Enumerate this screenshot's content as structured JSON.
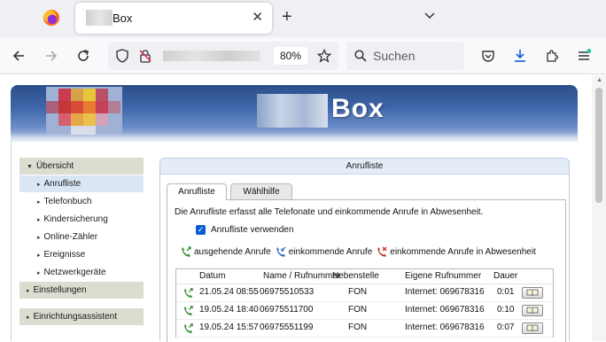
{
  "browser": {
    "tab_title": "Box",
    "url_zoom": "80%",
    "search_placeholder": "Suchen"
  },
  "header": {
    "title": "Box"
  },
  "sidebar": {
    "items": [
      {
        "label": "Übersicht",
        "level": "top",
        "expanded": true
      },
      {
        "label": "Anrufliste",
        "level": "sub",
        "selected": true
      },
      {
        "label": "Telefonbuch",
        "level": "sub"
      },
      {
        "label": "Kindersicherung",
        "level": "sub"
      },
      {
        "label": "Online-Zähler",
        "level": "sub"
      },
      {
        "label": "Ereignisse",
        "level": "sub"
      },
      {
        "label": "Netzwerkgeräte",
        "level": "sub"
      },
      {
        "label": "Einstellungen",
        "level": "top"
      },
      {
        "label": "Einrichtungsassistent",
        "level": "top"
      }
    ]
  },
  "panel": {
    "title": "Anrufliste",
    "tabs": [
      "Anrufliste",
      "Wählhilfe"
    ],
    "description": "Die Anrufliste erfasst alle Telefonate und einkommende Anrufe in Abwesenheit.",
    "checkbox_label": "Anrufliste verwenden",
    "legend": {
      "outgoing": "ausgehende Anrufe",
      "incoming": "einkommende Anrufe",
      "missed": "einkommende Anrufe in Abwesenheit"
    },
    "columns": [
      "Datum",
      "Name / Rufnummer",
      "Nebenstelle",
      "Eigene Rufnummer",
      "Dauer"
    ],
    "rows": [
      {
        "date": "21.05.24 08:55",
        "number": "06975510533",
        "extension": "FON",
        "own_number": "Internet: 069678316",
        "duration": "0:01"
      },
      {
        "date": "19.05.24 18:40",
        "number": "06975511700",
        "extension": "FON",
        "own_number": "Internet: 069678316",
        "duration": "0:10"
      },
      {
        "date": "19.05.24 15:57",
        "number": "06975551199",
        "extension": "FON",
        "own_number": "Internet: 069678316",
        "duration": "0:07"
      }
    ]
  },
  "colors": {
    "header_blue": "#3e66a8",
    "panel_title_bg": "#e4ecf7",
    "menu_top_bg": "#dcdcd0",
    "menu_selected_bg": "#dbe6f5",
    "checkbox_blue": "#0a5bd8",
    "outgoing_icon": "#2e8b2e",
    "incoming_icon": "#2f6fc8",
    "missed_icon": "#c8342a"
  }
}
